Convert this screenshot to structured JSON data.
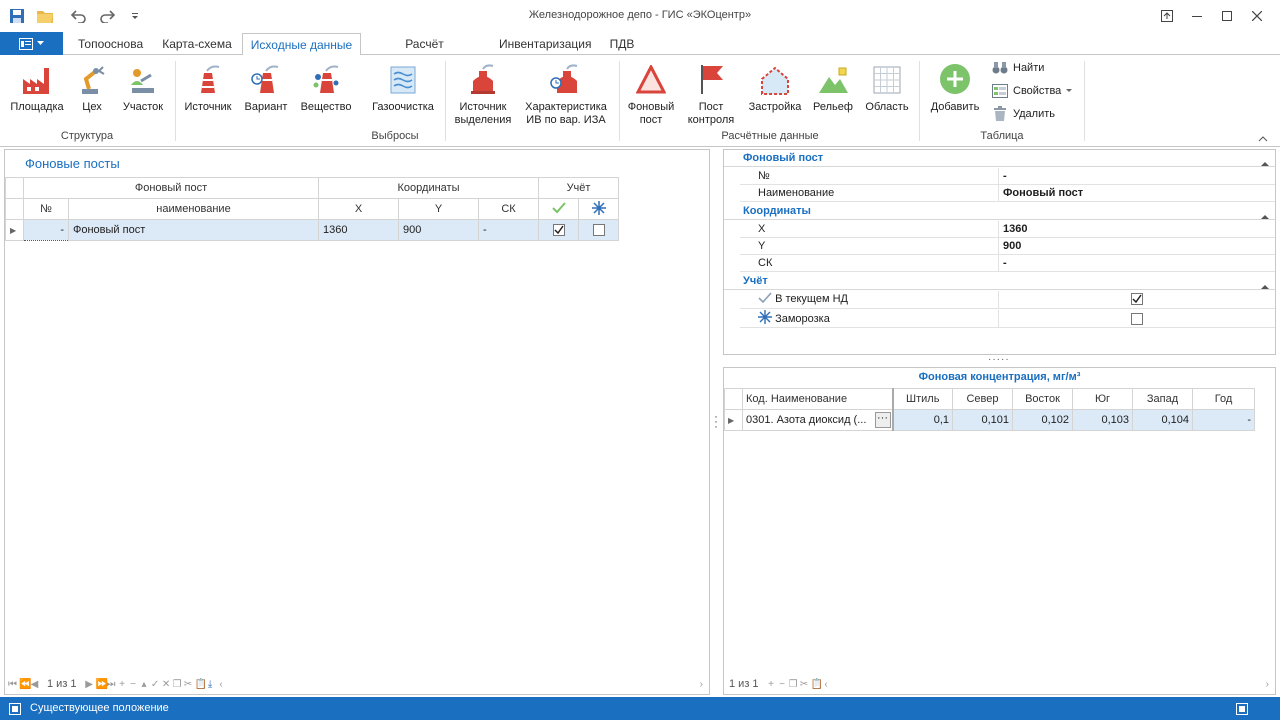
{
  "window": {
    "title": "Железнодорожное депо - ГИС «ЭКОцентр»"
  },
  "tabs": [
    "Топооснова",
    "Карта-схема",
    "Исходные данные",
    "Расчёт рассеивания",
    "Инвентаризация",
    "ПДВ"
  ],
  "ribbon": {
    "groups": {
      "structure": "Структура",
      "emissions": "Выбросы",
      "calc": "Расчётные данные",
      "table": "Таблица"
    },
    "buttons": {
      "site": "Площадка",
      "shop": "Цех",
      "section": "Участок",
      "source": "Источник",
      "variant": "Вариант",
      "substance": "Вещество",
      "gas_cleaning": "Газоочистка",
      "release_source_1": "Источник",
      "release_source_2": "выделения",
      "iv_char_1": "Характеристика",
      "iv_char_2": "ИВ по вар. ИЗА",
      "bg_post_1": "Фоновый",
      "bg_post_2": "пост",
      "control_post_1": "Пост",
      "control_post_2": "контроля",
      "building": "Застройка",
      "relief": "Рельеф",
      "area": "Область",
      "add": "Добавить",
      "find": "Найти",
      "properties": "Свойства",
      "delete": "Удалить"
    }
  },
  "left": {
    "title": "Фоновые посты",
    "groups": {
      "post": "Фоновый пост",
      "coords": "Координаты",
      "account": "Учёт"
    },
    "columns": {
      "no": "№",
      "name": "наименование",
      "x": "X",
      "y": "Y",
      "sk": "СК"
    },
    "rows": [
      {
        "no": "-",
        "name": "Фоновый пост",
        "x": "1360",
        "y": "900",
        "sk": "-",
        "current": true,
        "frozen": false
      }
    ],
    "nav": "1 из 1"
  },
  "props": {
    "cat_post": "Фоновый пост",
    "no_label": "№",
    "no_value": "-",
    "name_label": "Наименование",
    "name_value": "Фоновый пост",
    "cat_coords": "Координаты",
    "x_label": "X",
    "x_value": "1360",
    "y_label": "Y",
    "y_value": "900",
    "sk_label": "СК",
    "sk_value": "-",
    "cat_account": "Учёт",
    "current_label": "В текущем НД",
    "frozen_label": "Заморозка"
  },
  "conc": {
    "title": "Фоновая концентрация, мг/м³",
    "columns": [
      "Код. Наименование",
      "Штиль",
      "Север",
      "Восток",
      "Юг",
      "Запад",
      "Год"
    ],
    "rows": [
      {
        "name": "0301. Азота диоксид (...",
        "calm": "0,1",
        "north": "0,101",
        "east": "0,102",
        "south": "0,103",
        "west": "0,104",
        "year": "-"
      }
    ],
    "nav": "1 из 1"
  },
  "status": "Существующее положение",
  "colors": {
    "accent": "#1a6fc0",
    "selection": "#dce9f7",
    "icon_red": "#d9453a",
    "icon_green": "#7cc36a"
  }
}
